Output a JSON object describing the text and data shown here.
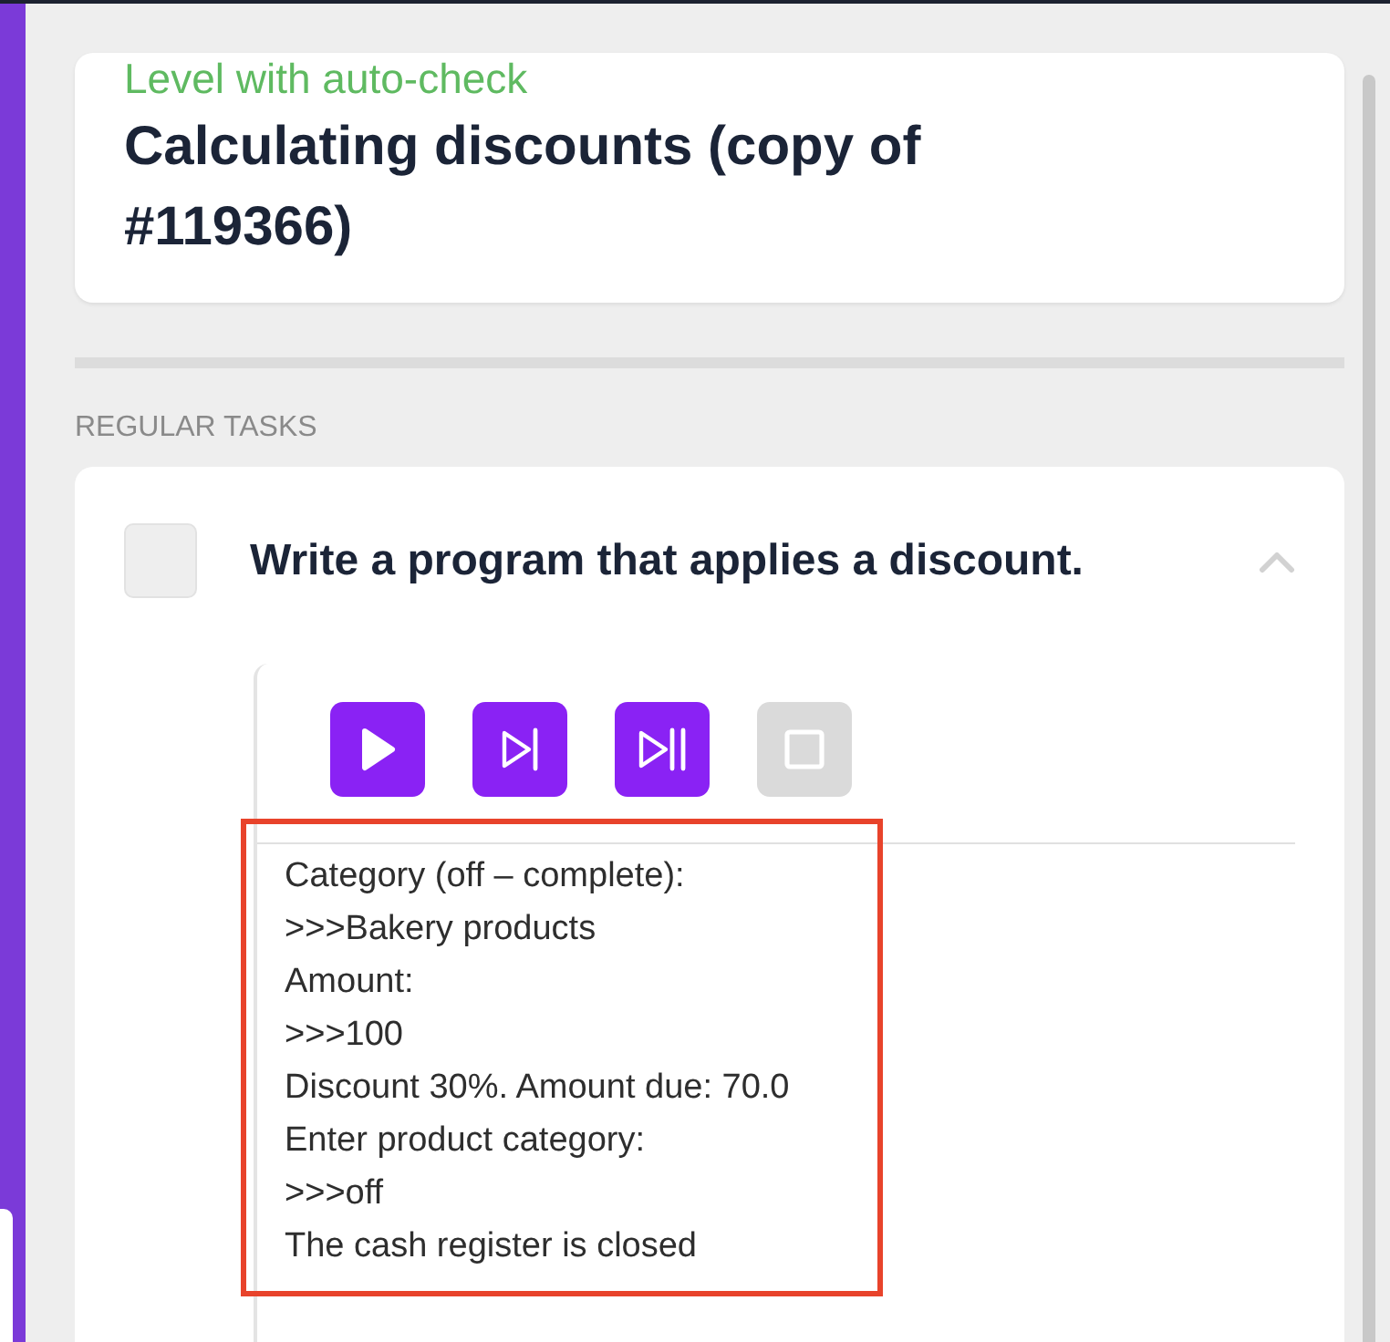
{
  "header": {
    "level_type": "Level with auto-check",
    "title": "Calculating discounts (copy of #119366)"
  },
  "section_label": "REGULAR TASKS",
  "tasks": [
    {
      "title": "Write a program that applies a discount.",
      "checked": false,
      "expanded": true,
      "toolbar": [
        {
          "kind": "run",
          "disabled": false
        },
        {
          "kind": "step",
          "disabled": false
        },
        {
          "kind": "step-through",
          "disabled": false
        },
        {
          "kind": "stop",
          "disabled": true
        }
      ],
      "console": {
        "highlighted": true,
        "lines": [
          "Category (off – complete):",
          ">>>Bakery products",
          "Amount:",
          ">>>100",
          "Discount 30%. Amount due: 70.0",
          "Enter product category:",
          ">>>off",
          "The cash register is closed"
        ]
      }
    }
  ]
}
